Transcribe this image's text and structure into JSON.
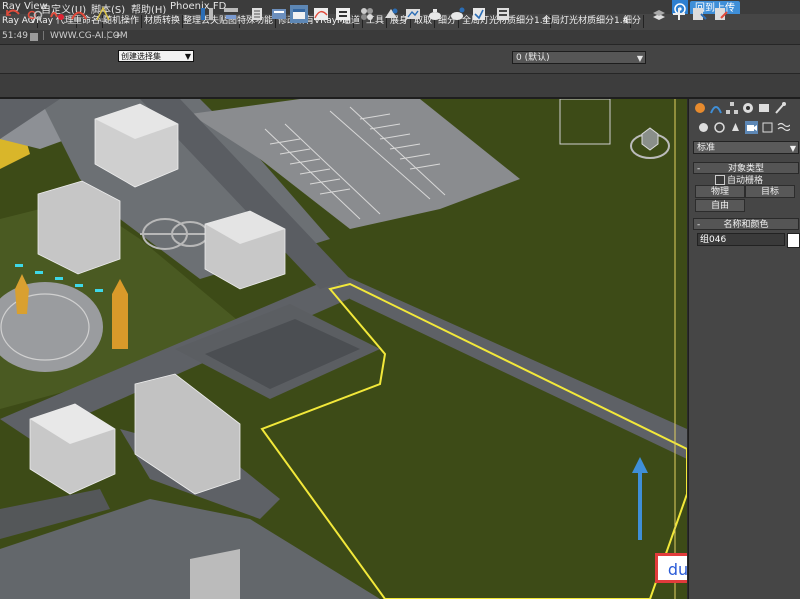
{
  "menu": {
    "items": [
      "Ray View",
      "自定义(U)",
      "脚本(S)",
      "帮助(H)",
      "Phoenix FD"
    ]
  },
  "upload": {
    "label": "回到上传"
  },
  "command_bar": {
    "buttons": [
      "Ray AO",
      "VRay 代理",
      "重命名",
      "随机操作",
      "材质转换",
      "整理丢失贴图",
      "特殊功能",
      "修改所有VRayMtl",
      "通道",
      "工具",
      "展身",
      "取取",
      "细分",
      "全局灯光材质细分1.4",
      "全局灯光材质细分1.4",
      "细分"
    ]
  },
  "tabs": {
    "time": "51:49",
    "website": "WWW.CG-AI.COM",
    "plus": "+"
  },
  "toolbar": {
    "selection_filter": "创建选择集",
    "layer_dropdown": "0 (默认)"
  },
  "panel": {
    "standard_label": "标准",
    "object_type_title": "对象类型",
    "autogrid_label": "自动栅格",
    "btn_physical": "物理",
    "btn_target": "目标",
    "btn_free": "自由",
    "name_color_title": "名称和颜色",
    "name_value": "组046",
    "minus": "-"
  },
  "colors": {
    "grass": "#3d4b17",
    "road": "#5a5e62",
    "highlight": "#f2e83a",
    "arrow": "#3f8fd8"
  },
  "watermark": {
    "text": "du"
  }
}
